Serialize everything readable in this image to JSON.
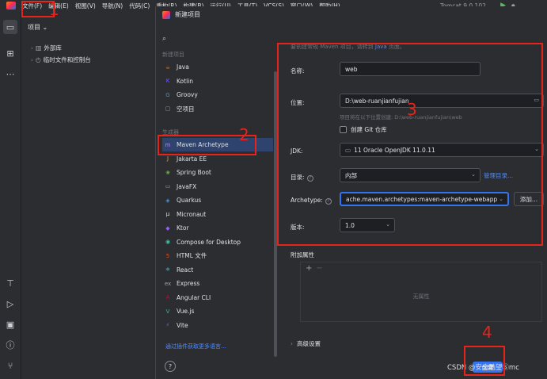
{
  "menubar": {
    "items": [
      "文件(F)",
      "编辑(E)",
      "视图(V)",
      "导航(N)",
      "代码(C)",
      "重构(R)",
      "构建(B)",
      "运行(U)",
      "工具(T)",
      "VCS(S)",
      "窗口(W)",
      "帮助(H)"
    ],
    "run_config": "Tomcat 9.0.102",
    "run_chevron": "⌄"
  },
  "project_panel": {
    "title": "项目",
    "title_chevron": "⌄",
    "tree": [
      {
        "label": "外部库",
        "arrow": "›"
      },
      {
        "label": "临时文件和控制台",
        "arrow": "›"
      }
    ]
  },
  "dialog": {
    "title": "新建项目",
    "sidebar": {
      "group_new": "新建项目",
      "group_generators": "生成器",
      "new_items": [
        {
          "label": "Java",
          "icon": "java-icon",
          "glyph": "☕",
          "color": "#e76f00"
        },
        {
          "label": "Kotlin",
          "icon": "kotlin-icon",
          "glyph": "K",
          "color": "#7f52ff"
        },
        {
          "label": "Groovy",
          "icon": "groovy-icon",
          "glyph": "G",
          "color": "#4298b8"
        },
        {
          "label": "空项目",
          "icon": "empty-project-icon",
          "glyph": "▢",
          "color": "#9da0a8"
        }
      ],
      "generator_items": [
        {
          "label": "Maven Archetype",
          "icon": "maven-icon",
          "glyph": "m",
          "color": "#c77dff"
        },
        {
          "label": "Jakarta EE",
          "icon": "jakarta-icon",
          "glyph": "J",
          "color": "#f0a732"
        },
        {
          "label": "Spring Boot",
          "icon": "spring-icon",
          "glyph": "❀",
          "color": "#6db33f"
        },
        {
          "label": "JavaFX",
          "icon": "javafx-icon",
          "glyph": "▭",
          "color": "#9da0a8"
        },
        {
          "label": "Quarkus",
          "icon": "quarkus-icon",
          "glyph": "◈",
          "color": "#4695eb"
        },
        {
          "label": "Micronaut",
          "icon": "micronaut-icon",
          "glyph": "μ",
          "color": "#dfe1e5"
        },
        {
          "label": "Ktor",
          "icon": "ktor-icon",
          "glyph": "◆",
          "color": "#9b59ff"
        },
        {
          "label": "Compose for Desktop",
          "icon": "compose-icon",
          "glyph": "◉",
          "color": "#41c2a8"
        },
        {
          "label": "HTML 文件",
          "icon": "html-icon",
          "glyph": "5",
          "color": "#e44d26"
        },
        {
          "label": "React",
          "icon": "react-icon",
          "glyph": "⚛",
          "color": "#61dafb"
        },
        {
          "label": "Express",
          "icon": "express-icon",
          "glyph": "ex",
          "color": "#9da0a8"
        },
        {
          "label": "Angular CLI",
          "icon": "angular-icon",
          "glyph": "A",
          "color": "#dd0031"
        },
        {
          "label": "Vue.js",
          "icon": "vue-icon",
          "glyph": "V",
          "color": "#41b883"
        },
        {
          "label": "Vite",
          "icon": "vite-icon",
          "glyph": "⚡",
          "color": "#bd34fe"
        }
      ],
      "plugin_link": "通过插件获取更多语言..."
    },
    "form": {
      "description": "要创建常规 Maven 项目，请转到",
      "description_link": "Java",
      "description_end": "页面。",
      "name_label": "名称:",
      "name_value": "web",
      "location_label": "位置:",
      "location_value": "D:\\web-ruanjianfujian",
      "location_hint": "项目将在以下位置创建: D:\\web-ruanjianfujian\\web",
      "git_label": "创建 Git 仓库",
      "jdk_label": "JDK:",
      "jdk_value": "11  Oracle OpenJDK 11.0.11",
      "catalog_label": "目录:",
      "catalog_value": "内部",
      "catalog_manage": "管理目录...",
      "archetype_label": "Archetype:",
      "archetype_value": "ache.maven.archetypes:maven-archetype-webapp",
      "archetype_add": "添加...",
      "version_label": "版本:",
      "version_value": "1.0",
      "chevron": "⌄"
    },
    "props": {
      "title": "附加属性",
      "add": "+",
      "remove": "−",
      "empty": "无属性"
    },
    "advanced": "高级设置",
    "advanced_arrow": "›",
    "help_glyph": "?",
    "create_button": "创建"
  },
  "annotations": {
    "numbers": [
      "1",
      "2",
      "3",
      "4"
    ],
    "color": "#e8231c"
  },
  "watermark": "CSDN @安全酷望Ⓢmc"
}
